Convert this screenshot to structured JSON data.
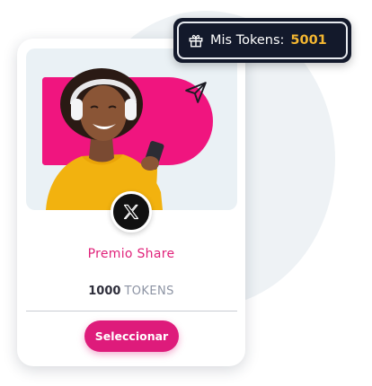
{
  "tokens_badge": {
    "label": "Mis Tokens:",
    "value": "5001",
    "icon": "gift-icon",
    "value_color": "#f5b731"
  },
  "reward_card": {
    "hero_image": "woman-with-headphones-and-phone",
    "hero_accent_color": "#f0157f",
    "share_icon": "send-icon",
    "social_icon": "x-logo-icon",
    "title": "Premio Share",
    "price_amount": "1000",
    "price_unit": "TOKENS",
    "select_label": "Seleccionar",
    "accent_color": "#de1b7b"
  }
}
